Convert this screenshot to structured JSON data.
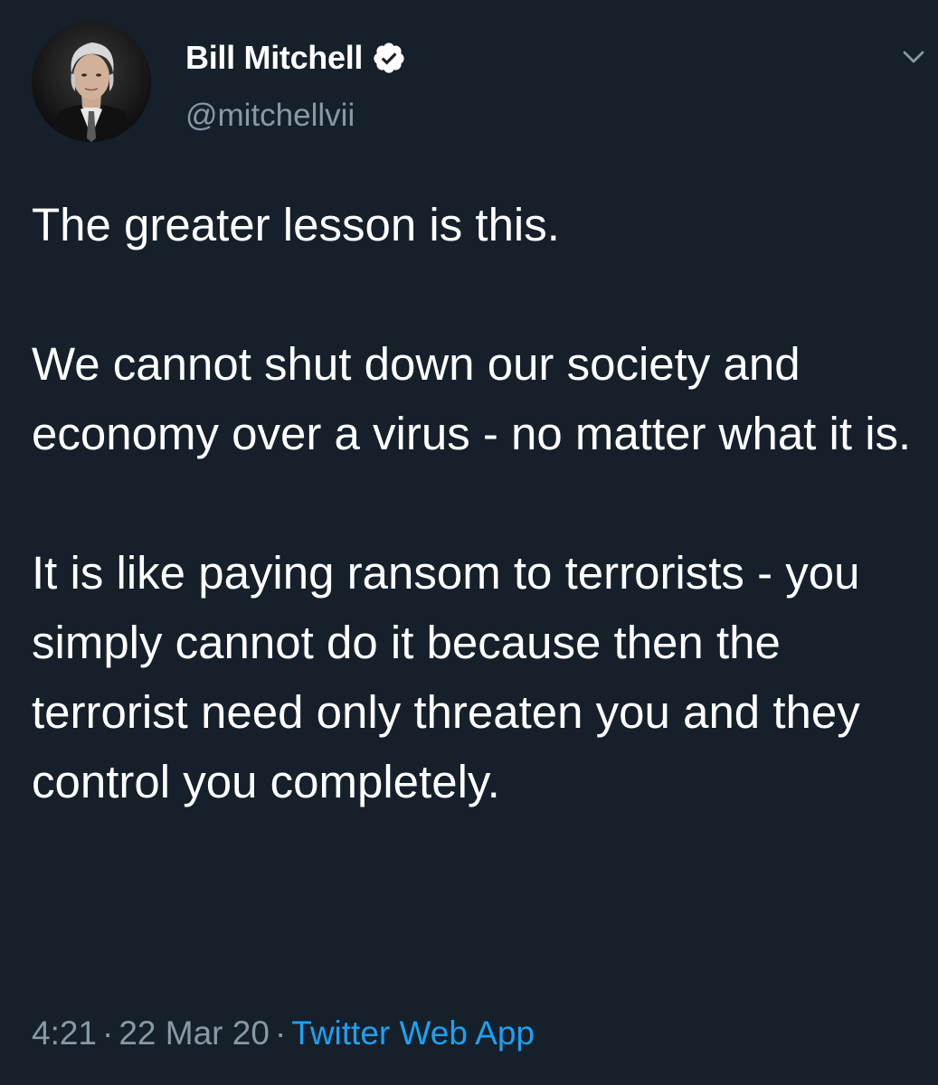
{
  "author": {
    "display_name": "Bill Mitchell",
    "handle": "@mitchellvii",
    "verified": true
  },
  "tweet": {
    "paragraphs": [
      "The greater lesson is this.",
      "We cannot shut down our society and economy over a virus - no matter what it is.",
      "It is like paying ransom to terrorists - you simply cannot do it because then the terrorist need only threaten you and they control you completely."
    ]
  },
  "meta": {
    "time": "4:21",
    "separator": "·",
    "date": "22 Mar 20",
    "source": "Twitter Web App"
  },
  "icons": {
    "avatar": "profile-photo",
    "verified": "verified-badge-icon",
    "menu": "chevron-down-icon"
  },
  "colors": {
    "background": "#15202b",
    "text": "#ffffff",
    "secondary_text": "#8899a6",
    "link": "#1da1f2"
  }
}
